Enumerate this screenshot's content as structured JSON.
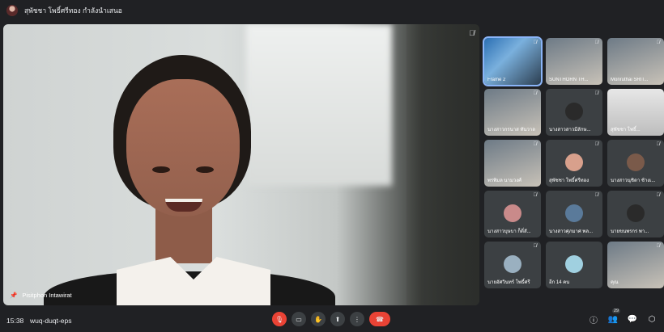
{
  "topbar": {
    "presenter_text": "สุพัชชา โพธิ์ศรีทอง กำลังนำเสนอ"
  },
  "main_video": {
    "participant_name": "Pisitphon Intawirat"
  },
  "grid": {
    "tiles": [
      {
        "name": "Frame 2",
        "muted": true,
        "variant": "screen"
      },
      {
        "name": "SUNTHORN TH...",
        "muted": true,
        "variant": "camera"
      },
      {
        "name": "Monruthai SRIT...",
        "muted": true,
        "variant": "camera"
      },
      {
        "name": "นางสาวกรนาส ทันวาล",
        "muted": true,
        "variant": "camera"
      },
      {
        "name": "นางสาวสาวมีลักษ...",
        "muted": true,
        "variant": "avatar"
      },
      {
        "name": "สุพัชชา โพธิ์...",
        "muted": false,
        "variant": "presenting"
      },
      {
        "name": "พรพิมล นามวงศ์",
        "muted": true,
        "variant": "camera"
      },
      {
        "name": "สุพัชชา โพธิ์ศรีทอง",
        "muted": true,
        "variant": "avatar"
      },
      {
        "name": "นางสาวนุชิดา ช้างเ...",
        "muted": true,
        "variant": "avatar"
      },
      {
        "name": "นางสาวบุษบา ก็ดี่สั...",
        "muted": true,
        "variant": "avatar"
      },
      {
        "name": "นางสาวศุภมาศ พล...",
        "muted": true,
        "variant": "avatar"
      },
      {
        "name": "นายขนพรกร พา...",
        "muted": true,
        "variant": "avatar"
      },
      {
        "name": "นายอัศวินทร์ โพธิ์ศรี",
        "muted": true,
        "variant": "avatar"
      },
      {
        "name": "อีก 14 คน",
        "muted": false,
        "variant": "more"
      },
      {
        "name": "คุณ",
        "muted": true,
        "variant": "camera"
      }
    ]
  },
  "bottombar": {
    "time": "15:38",
    "meeting_code": "wuq-duqt-eps",
    "participants_count": "29"
  },
  "colors": {
    "background": "#202124",
    "hangup": "#ea4335",
    "active_outline": "#8ab4f8"
  }
}
